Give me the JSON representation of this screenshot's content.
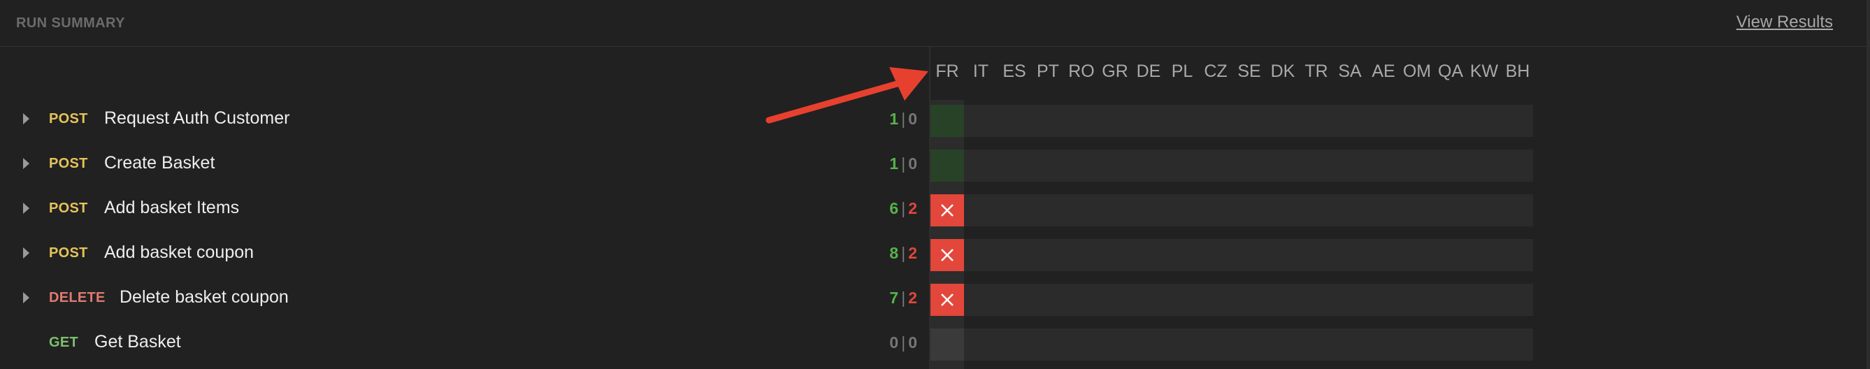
{
  "header": {
    "title": "RUN SUMMARY",
    "view_results": "View Results"
  },
  "countries": [
    "FR",
    "IT",
    "ES",
    "PT",
    "RO",
    "GR",
    "DE",
    "PL",
    "CZ",
    "SE",
    "DK",
    "TR",
    "SA",
    "AE",
    "OM",
    "QA",
    "KW",
    "BH"
  ],
  "requests": [
    {
      "method": "POST",
      "name": "Request Auth Customer",
      "passed": "1",
      "failed": "0",
      "fr_status": "pass",
      "expandable": true
    },
    {
      "method": "POST",
      "name": "Create Basket",
      "passed": "1",
      "failed": "0",
      "fr_status": "pass",
      "expandable": true
    },
    {
      "method": "POST",
      "name": "Add basket Items",
      "passed": "6",
      "failed": "2",
      "fr_status": "fail",
      "expandable": true
    },
    {
      "method": "POST",
      "name": "Add basket coupon",
      "passed": "8",
      "failed": "2",
      "fr_status": "fail",
      "expandable": true
    },
    {
      "method": "DELETE",
      "name": "Delete basket coupon",
      "passed": "7",
      "failed": "2",
      "fr_status": "fail",
      "expandable": true
    },
    {
      "method": "GET",
      "name": "Get Basket",
      "passed": "0",
      "failed": "0",
      "fr_status": "none",
      "expandable": false
    }
  ],
  "colors": {
    "pass": "#58b14c",
    "fail": "#e0473b",
    "post": "#e6c35a",
    "delete": "#e07a72",
    "get": "#7dbf6e",
    "annotation_arrow": "#e8402f"
  },
  "icons": {
    "fail_cell": "close-icon",
    "expand": "caret-right-icon",
    "annotation": "arrow-icon"
  }
}
